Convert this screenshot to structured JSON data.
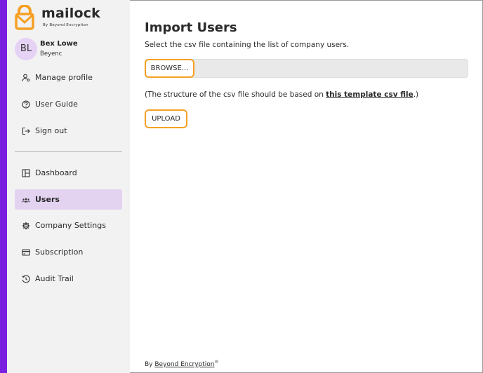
{
  "brand": {
    "name": "mailock",
    "tagline": "By Beyond Encryption",
    "accent_color": "#7a1fe0",
    "logo_color": "#f5a024"
  },
  "profile": {
    "initials": "BL",
    "name": "Bex Lowe",
    "org": "Beyenc"
  },
  "account_menu": [
    {
      "label": "Manage profile",
      "icon": "user-gear-icon"
    },
    {
      "label": "User Guide",
      "icon": "help-circle-icon"
    },
    {
      "label": "Sign out",
      "icon": "sign-out-icon"
    }
  ],
  "nav": [
    {
      "label": "Dashboard",
      "icon": "dashboard-icon",
      "active": false
    },
    {
      "label": "Users",
      "icon": "users-icon",
      "active": true
    },
    {
      "label": "Company Settings",
      "icon": "gear-icon",
      "active": false
    },
    {
      "label": "Subscription",
      "icon": "credit-card-icon",
      "active": false
    },
    {
      "label": "Audit Trail",
      "icon": "history-icon",
      "active": false
    }
  ],
  "main": {
    "title": "Import Users",
    "subtitle": "Select the csv file containing the list of company users.",
    "browse_label": "BROWSE...",
    "file_value": "",
    "note_prefix": "(The structure of the csv file should be based on ",
    "note_link": "this template csv file",
    "note_suffix": ".)",
    "upload_label": "UPLOAD"
  },
  "footer": {
    "prefix": "By ",
    "link": "Beyond Encryption",
    "mark": "®"
  }
}
